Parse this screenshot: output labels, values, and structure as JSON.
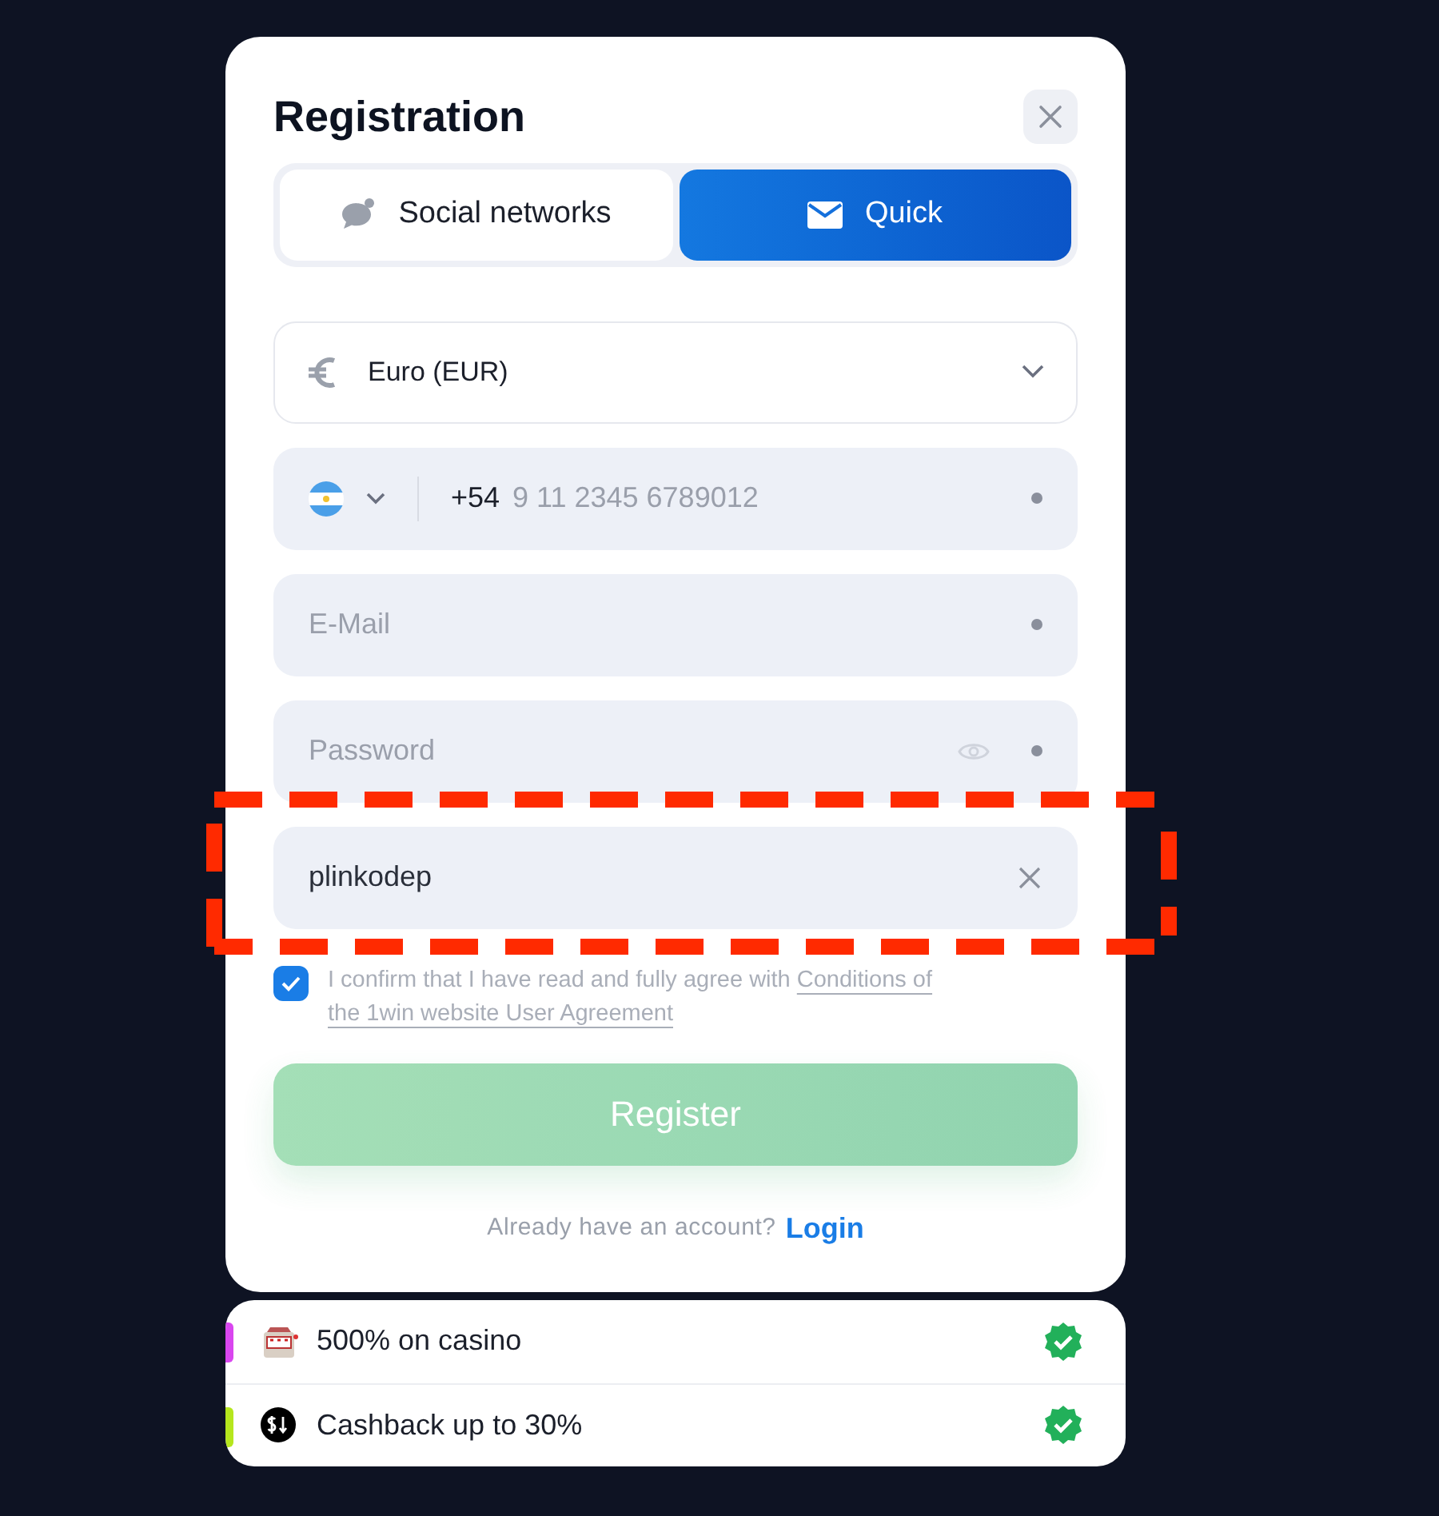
{
  "modal": {
    "title": "Registration",
    "tabs": [
      {
        "label": "Social networks",
        "selected": false
      },
      {
        "label": "Quick",
        "selected": true
      }
    ],
    "currency": {
      "value": "Euro (EUR)"
    },
    "fields": [
      {
        "kind": "phone",
        "prefix": "+54",
        "placeholder": "9 11 2345 6789012",
        "required": true
      },
      {
        "kind": "email",
        "placeholder": "E-Mail",
        "required": true
      },
      {
        "kind": "password",
        "placeholder": "Password",
        "required": true
      },
      {
        "kind": "promo",
        "value": "plinkodep"
      }
    ],
    "consent": {
      "checked": true,
      "text": "I confirm that I have read and fully agree with",
      "link_lines": [
        "Conditions of",
        "the 1win website User Agreement"
      ]
    },
    "register_button": {
      "label": "Register",
      "disabled": true
    },
    "login_prompt": {
      "text": "Already have an account?",
      "link": "Login"
    }
  },
  "bonuses": [
    {
      "label": "500% on casino",
      "color": "#d946ef",
      "kind": "slot",
      "verified": true
    },
    {
      "label": "Cashback up to 30%",
      "color": "#b5e61d",
      "kind": "cashback",
      "verified": true
    }
  ]
}
